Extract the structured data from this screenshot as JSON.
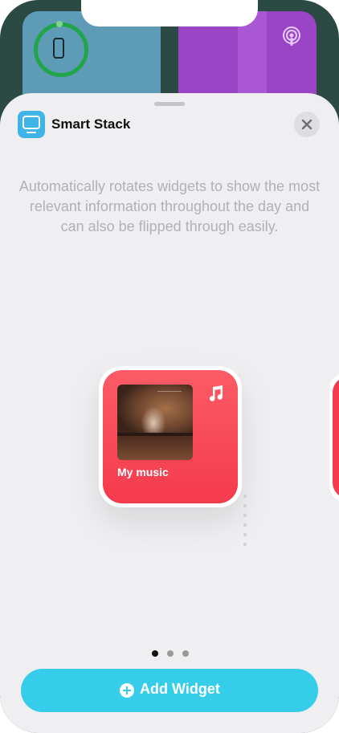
{
  "home_screen": {
    "widgets": [
      "battery-widget",
      "podcasts-widget"
    ]
  },
  "sheet": {
    "title": "Smart Stack",
    "description": "Automatically rotates widgets to show the most relevant information throughout the day and can also be flipped through easily.",
    "widget": {
      "label": "My music",
      "app_icon": "music-note-icon"
    },
    "page_indicator": {
      "count": 3,
      "active_index": 0
    },
    "add_button_label": "Add Widget"
  },
  "colors": {
    "accent": "#36cdea",
    "widget_red": "#f53a4c",
    "sheet_bg": "#efeff1",
    "description_text": "#b1b1b6"
  }
}
